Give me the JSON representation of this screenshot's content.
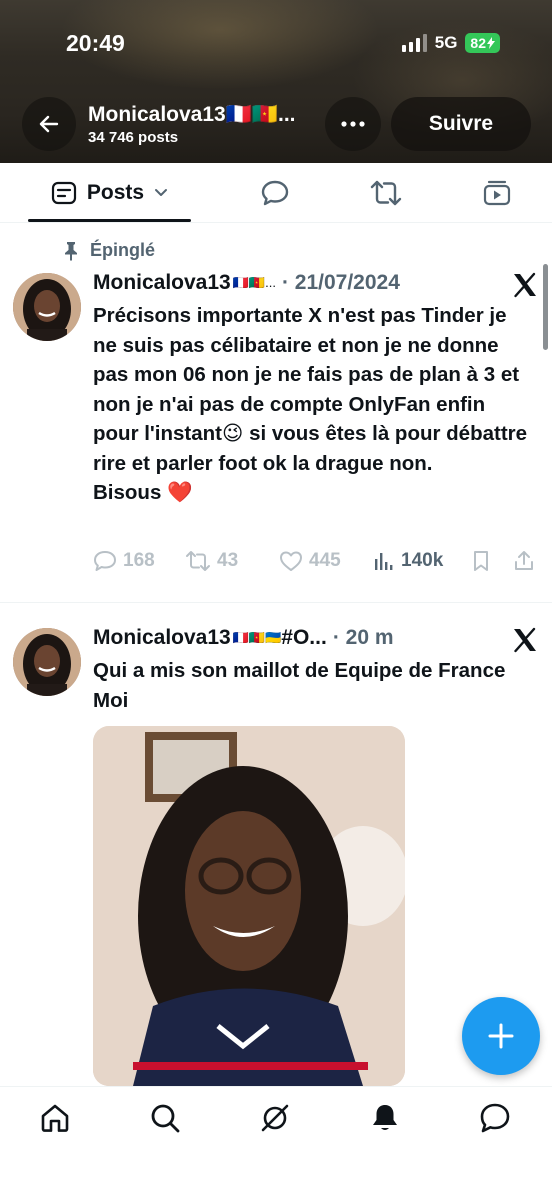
{
  "status_bar": {
    "time": "20:49",
    "network": "5G",
    "battery": "82"
  },
  "profile": {
    "name": "Monicalova13🇫🇷🇨🇲...",
    "posts_count": "34 746 posts",
    "follow_label": "Suivre"
  },
  "tabs": [
    {
      "label": "Posts",
      "icon": "posts-icon"
    },
    {
      "icon": "replies-icon"
    },
    {
      "icon": "repost-icon"
    },
    {
      "icon": "media-icon"
    }
  ],
  "tweets": [
    {
      "pinned_label": "Épinglé",
      "name": "Monicalova13",
      "flags": "🇫🇷🇨🇲...",
      "meta": "· 21/07/2024",
      "text": "Précisons importante X n'est pas Tinder je ne suis pas célibataire et non je ne donne pas mon 06 non je ne fais pas de plan à 3 et non je n'ai pas de compte OnlyFan enfin pour l'instant😉 si vous êtes là pour débattre rire et parler foot ok la drague non.\nBisous ❤️",
      "replies": "168",
      "reposts": "43",
      "likes": "445",
      "views": "140k"
    },
    {
      "name": "Monicalova13",
      "flags": "🇫🇷🇨🇲🇺🇦",
      "name_suffix": " #O...",
      "meta": "· 20 m",
      "text": "Qui a mis son maillot de Equipe de France Moi"
    }
  ],
  "colors": {
    "accent": "#1d9bf0",
    "text_primary": "#0f1419",
    "text_secondary": "#536471",
    "like_heart": "#e0245e",
    "battery": "#34c759"
  }
}
